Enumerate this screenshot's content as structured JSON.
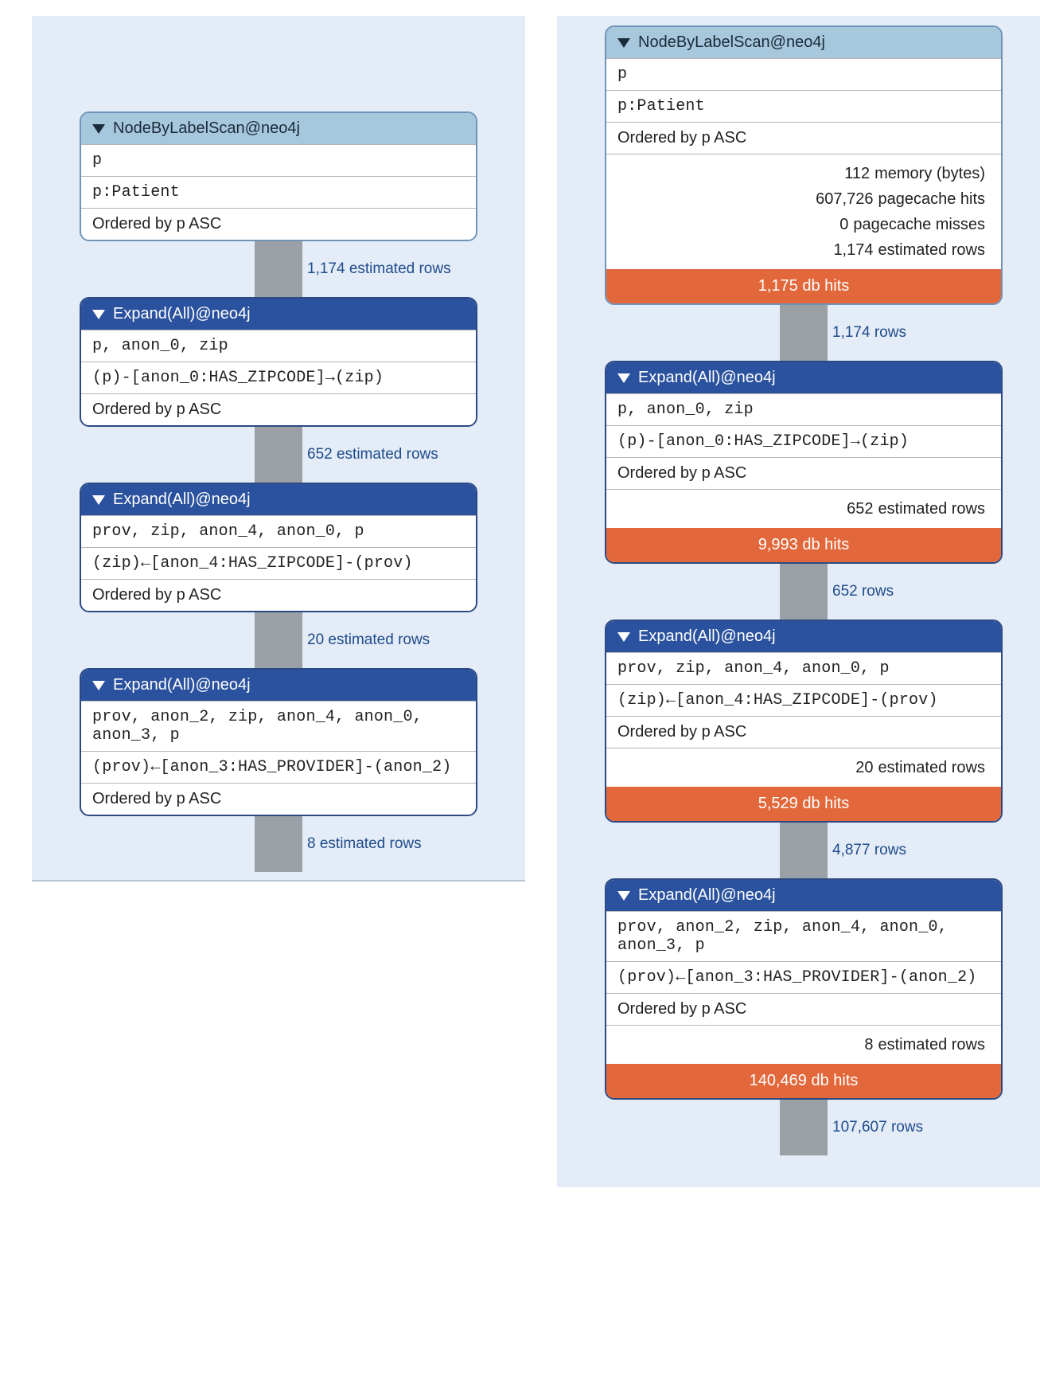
{
  "left": {
    "nodes": [
      {
        "header": "NodeByLabelScan@neo4j",
        "light": true,
        "rows": [
          {
            "mono": true,
            "text": "p"
          },
          {
            "mono": true,
            "text": "p:Patient"
          },
          {
            "mono": false,
            "text": "Ordered by p ASC"
          }
        ],
        "connector": "1,174 estimated rows"
      },
      {
        "header": "Expand(All)@neo4j",
        "light": false,
        "rows": [
          {
            "mono": true,
            "text": "p, anon_0, zip"
          },
          {
            "mono": true,
            "text": "(p)-[anon_0:HAS_ZIPCODE]→(zip)"
          },
          {
            "mono": false,
            "text": "Ordered by p ASC"
          }
        ],
        "connector": "652 estimated rows"
      },
      {
        "header": "Expand(All)@neo4j",
        "light": false,
        "rows": [
          {
            "mono": true,
            "text": "prov, zip, anon_4, anon_0, p"
          },
          {
            "mono": true,
            "text": "(zip)←[anon_4:HAS_ZIPCODE]-(prov)"
          },
          {
            "mono": false,
            "text": "Ordered by p ASC"
          }
        ],
        "connector": "20 estimated rows"
      },
      {
        "header": "Expand(All)@neo4j",
        "light": false,
        "rows": [
          {
            "mono": true,
            "text": "prov, anon_2, zip, anon_4, anon_0, anon_3, p"
          },
          {
            "mono": true,
            "text": "(prov)←[anon_3:HAS_PROVIDER]-(anon_2)"
          },
          {
            "mono": false,
            "text": "Ordered by p ASC"
          }
        ],
        "connector": "8 estimated rows"
      }
    ]
  },
  "right": {
    "nodes": [
      {
        "header": "NodeByLabelScan@neo4j",
        "light": true,
        "rows": [
          {
            "mono": true,
            "text": "p"
          },
          {
            "mono": true,
            "text": "p:Patient"
          },
          {
            "mono": false,
            "text": "Ordered by p ASC"
          }
        ],
        "metrics": [
          {
            "num": "112",
            "label": "memory (bytes)"
          },
          {
            "num": "607,726",
            "label": "pagecache hits"
          },
          {
            "num": "0",
            "label": "pagecache misses"
          },
          {
            "num": "1,174",
            "label": "estimated rows"
          }
        ],
        "dbhits": "1,175 db hits",
        "connector": "1,174 rows"
      },
      {
        "header": "Expand(All)@neo4j",
        "light": false,
        "rows": [
          {
            "mono": true,
            "text": "p, anon_0, zip"
          },
          {
            "mono": true,
            "text": "(p)-[anon_0:HAS_ZIPCODE]→(zip)"
          },
          {
            "mono": false,
            "text": "Ordered by p ASC"
          }
        ],
        "metrics": [
          {
            "num": "652",
            "label": "estimated rows"
          }
        ],
        "dbhits": "9,993 db hits",
        "connector": "652 rows"
      },
      {
        "header": "Expand(All)@neo4j",
        "light": false,
        "rows": [
          {
            "mono": true,
            "text": "prov, zip, anon_4, anon_0, p"
          },
          {
            "mono": true,
            "text": "(zip)←[anon_4:HAS_ZIPCODE]-(prov)"
          },
          {
            "mono": false,
            "text": "Ordered by p ASC"
          }
        ],
        "metrics": [
          {
            "num": "20",
            "label": "estimated rows"
          }
        ],
        "dbhits": "5,529 db hits",
        "connector": "4,877 rows"
      },
      {
        "header": "Expand(All)@neo4j",
        "light": false,
        "rows": [
          {
            "mono": true,
            "text": "prov, anon_2, zip, anon_4, anon_0, anon_3, p"
          },
          {
            "mono": true,
            "text": "(prov)←[anon_3:HAS_PROVIDER]-(anon_2)"
          },
          {
            "mono": false,
            "text": "Ordered by p ASC"
          }
        ],
        "metrics": [
          {
            "num": "8",
            "label": "estimated rows"
          }
        ],
        "dbhits": "140,469 db hits",
        "connector": "107,607 rows"
      }
    ]
  }
}
